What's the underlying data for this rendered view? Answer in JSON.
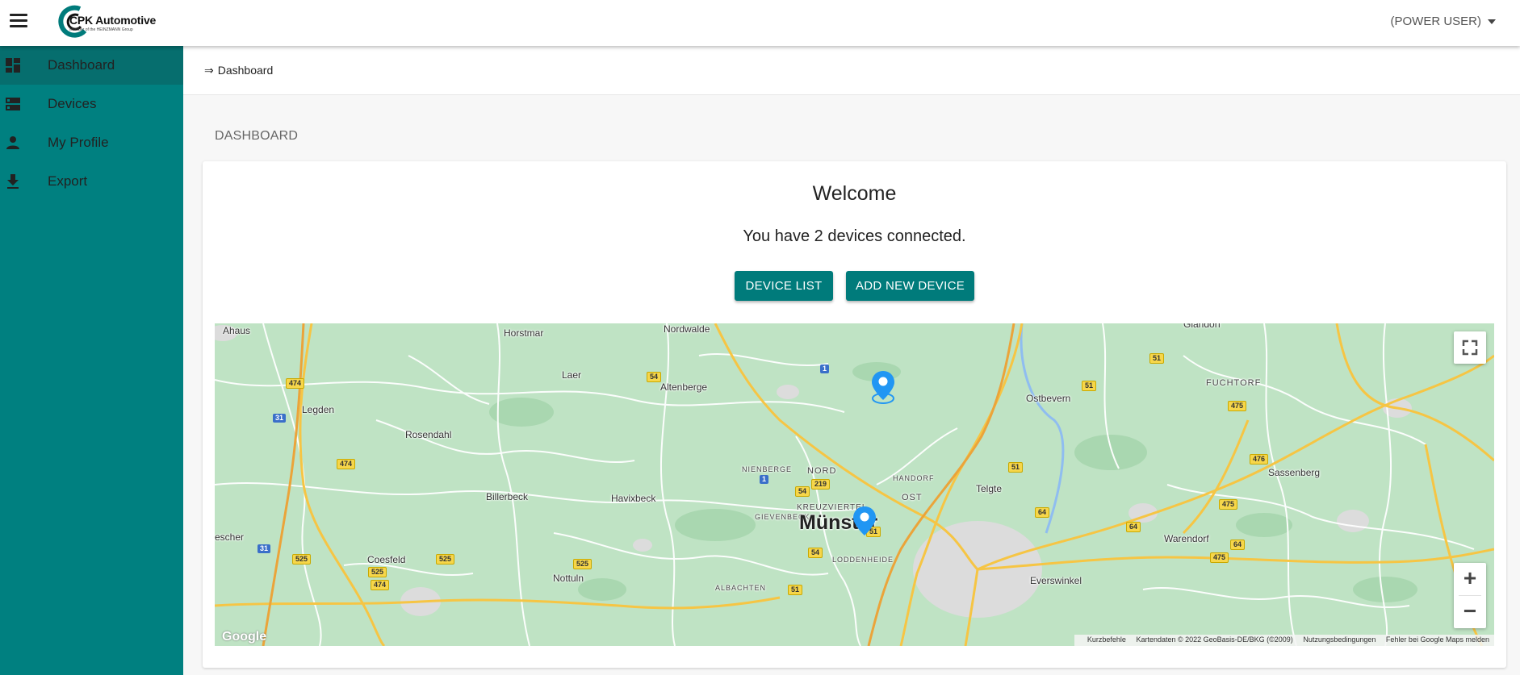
{
  "header": {
    "brand": "CPK Automotive",
    "brand_sub": "Member of the HEINZMANN Group",
    "user_role": "(POWER USER)"
  },
  "sidebar": {
    "items": [
      {
        "label": "Dashboard",
        "icon": "dashboard-icon",
        "active": true
      },
      {
        "label": "Devices",
        "icon": "devices-icon",
        "active": false
      },
      {
        "label": "My Profile",
        "icon": "person-icon",
        "active": false
      },
      {
        "label": "Export",
        "icon": "download-icon",
        "active": false
      }
    ]
  },
  "breadcrumb": {
    "arrow": "⇒",
    "current": "Dashboard"
  },
  "page": {
    "heading": "DASHBOARD"
  },
  "card": {
    "welcome": "Welcome",
    "devices_text": "You have 2 devices connected.",
    "device_list_label": "DEVICE LIST",
    "add_device_label": "ADD NEW DEVICE"
  },
  "map": {
    "places": {
      "ahaus": "Ahaus",
      "horstmar": "Horstmar",
      "nordwalde": "Nordwalde",
      "laer": "Laer",
      "altenberge": "Altenberge",
      "legden": "Legden",
      "rosendahl": "Rosendahl",
      "ostbevern": "Ostbevern",
      "fuchtorf": "FUCHTORF",
      "billerbeck": "Billerbeck",
      "havixbeck": "Havixbeck",
      "nienberge": "NIENBERGE",
      "nord": "NORD",
      "handorf": "HANDORF",
      "telgte": "Telgte",
      "sassenberg": "Sassenberg",
      "kreuzviertel": "KREUZVIERTEL",
      "ost": "OST",
      "gievenbeck": "GIEVENBECK",
      "muenster": "Münster",
      "warendorf": "Warendorf",
      "escher": "escher",
      "coesfeld": "Coesfeld",
      "loddenheide": "LODDENHEIDE",
      "nottuln": "Nottuln",
      "everswinkel": "Everswinkel",
      "albachten": "ALBACHTEN",
      "glandorf": "Glandorf"
    },
    "google": "Google",
    "attribution": {
      "shortcuts": "Kurzbefehle",
      "mapdata": "Kartendaten © 2022 GeoBasis-DE/BKG (©2009)",
      "terms": "Nutzungsbedingungen",
      "report": "Fehler bei Google Maps melden"
    },
    "zoom_in": "+",
    "zoom_out": "−",
    "pin_count": 2
  },
  "colors": {
    "sidebar": "#008080",
    "sidebar_active": "#066e6e",
    "button": "#007b7b",
    "map_green": "#bfe3c4",
    "pin": "#2196f3"
  }
}
